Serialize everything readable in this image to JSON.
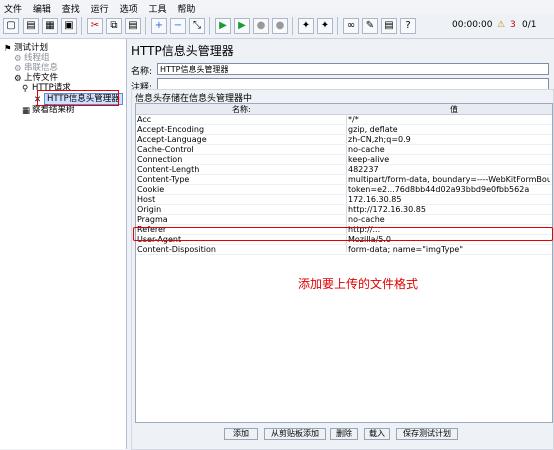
{
  "menu": [
    "文件",
    "编辑",
    "查找",
    "运行",
    "选项",
    "工具",
    "帮助"
  ],
  "toolbar": {
    "timer": "00:00:00",
    "warning_count": "3",
    "threads": "0/1"
  },
  "tree": {
    "root": "测试计划",
    "thread_group": "线程组",
    "sample_info": "串联信息",
    "upload": "上传文件",
    "http_request": "HTTP请求",
    "header_manager": "HTTP信息头管理器",
    "results": "察看结果树"
  },
  "panel": {
    "title": "HTTP信息头管理器",
    "name_label": "名称:",
    "name_value": "HTTP信息头管理器",
    "comment_label": "注释:",
    "comment_value": "",
    "group_title": "信息头存储在信息头管理器中",
    "col_name": "名称:",
    "col_value": "值",
    "rows": [
      [
        "Acc",
        "*/*"
      ],
      [
        "Accept-Encoding",
        "gzip, deflate"
      ],
      [
        "Accept-Language",
        "zh-CN,zh;q=0.9"
      ],
      [
        "Cache-Control",
        "no-cache"
      ],
      [
        "Connection",
        "keep-alive"
      ],
      [
        "Content-Length",
        "482237"
      ],
      [
        "Content-Type",
        "multipart/form-data, boundary=----WebKitFormBoundaryjiG2TuXIE..."
      ],
      [
        "Cookie",
        "token=e2...76d8bb44d02a93bbd9e0fbb562a"
      ],
      [
        "Host",
        "172.16.30.85"
      ],
      [
        "Origin",
        "http://172.16.30.85"
      ],
      [
        "Pragma",
        "no-cache"
      ],
      [
        "Referer",
        "http://..."
      ],
      [
        "User-Agent",
        "Mozilla/5.0"
      ],
      [
        "Content-Disposition",
        "form-data; name=\"imgType\""
      ]
    ],
    "note": "添加要上传的文件格式",
    "buttons": [
      "添加",
      "从剪贴板添加",
      "删除",
      "载入",
      "保存测试计划"
    ]
  }
}
